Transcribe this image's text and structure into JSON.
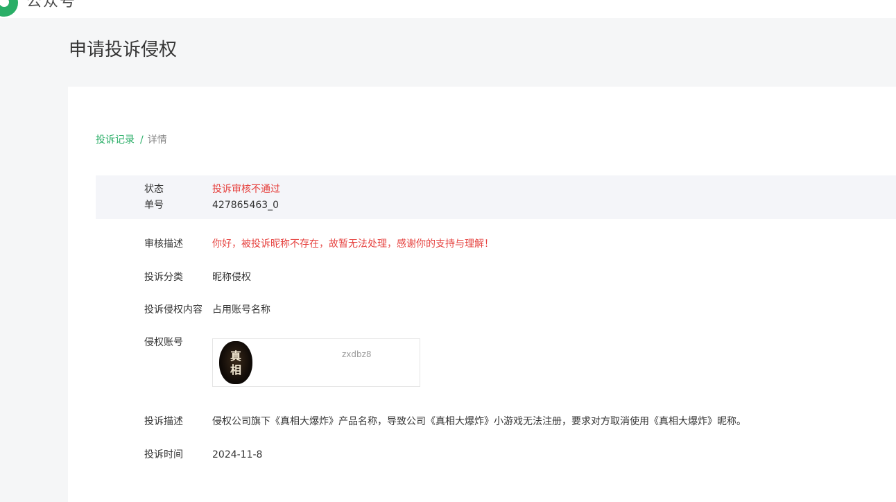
{
  "header": {
    "logo_text": "公众号",
    "icon": "wechat-logo-icon"
  },
  "page": {
    "title": "申请投诉侵权"
  },
  "breadcrumb": {
    "parent": "投诉记录",
    "separator": "/",
    "current": "详情"
  },
  "status": {
    "status_label": "状态",
    "status_value": "投诉审核不通过",
    "number_label": "单号",
    "number_value": "427865463_0"
  },
  "details": {
    "review_label": "审核描述",
    "review_value": "你好，被投诉昵称不存在，故暂无法处理，感谢你的支持与理解！",
    "category_label": "投诉分类",
    "category_value": "昵称侵权",
    "content_label": "投诉侵权内容",
    "content_value": "占用账号名称",
    "account_label": "侵权账号",
    "account_name": "zxdbz8",
    "avatar_text_top": "真",
    "avatar_text_bottom": "相",
    "desc_label": "投诉描述",
    "desc_value": "侵权公司旗下《真相大爆炸》产品名称，导致公司《真相大爆炸》小游戏无法注册，要求对方取消使用《真相大爆炸》昵称。",
    "time_label": "投诉时间",
    "time_value": "2024-11-8"
  },
  "colors": {
    "accent": "#2aae67",
    "error": "#e64340",
    "background": "#f5f6f7"
  }
}
